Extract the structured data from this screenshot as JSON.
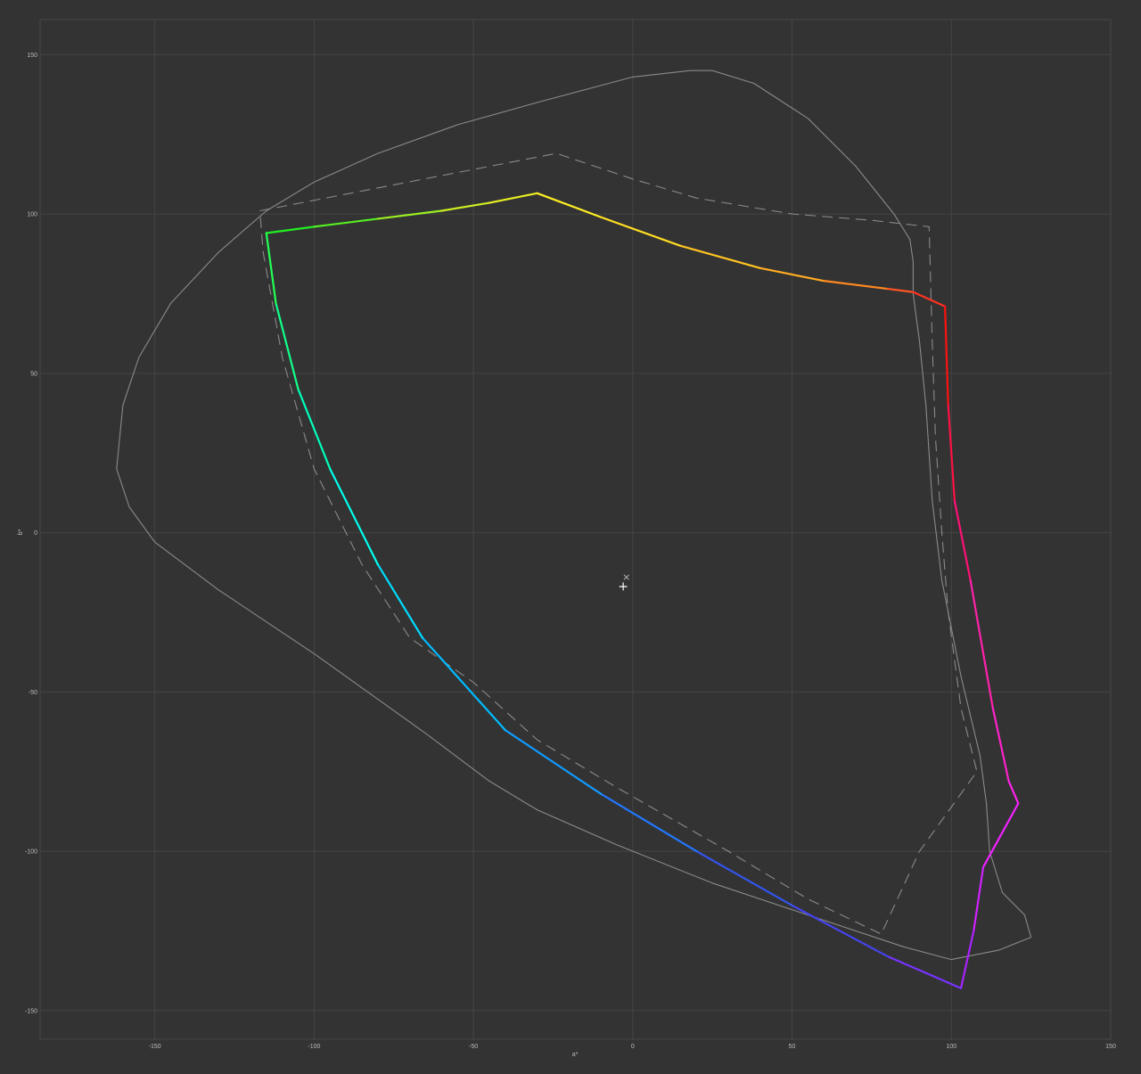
{
  "chart_data": {
    "type": "line",
    "title": "",
    "xlabel": "a*",
    "ylabel": "b*",
    "xlim": [
      -186,
      150
    ],
    "ylim": [
      -159,
      161
    ],
    "x_ticks": [
      -150,
      -100,
      -50,
      0,
      50,
      100,
      150
    ],
    "y_ticks": [
      -150,
      -100,
      -50,
      0,
      50,
      100,
      150
    ],
    "grid": true,
    "legend": "none",
    "colors": {
      "background": "#333333",
      "frame": "#474747",
      "grid": "#454545",
      "tick_text": "#bdbdbd",
      "reference_line": "#8a8a8a"
    },
    "series": [
      {
        "style": "solid-gray",
        "points": [
          [
            18,
            145
          ],
          [
            0,
            143
          ],
          [
            -30,
            135
          ],
          [
            -55,
            128
          ],
          [
            -80,
            119
          ],
          [
            -100,
            110
          ],
          [
            -115,
            101
          ],
          [
            -130,
            88
          ],
          [
            -145,
            72
          ],
          [
            -155,
            55
          ],
          [
            -160,
            40
          ],
          [
            -162,
            20
          ],
          [
            -158,
            8
          ],
          [
            -150,
            -3
          ],
          [
            -130,
            -18
          ],
          [
            -100,
            -38
          ],
          [
            -65,
            -63
          ],
          [
            -45,
            -78
          ],
          [
            -30,
            -87
          ],
          [
            -5,
            -98
          ],
          [
            25,
            -110
          ],
          [
            55,
            -120
          ],
          [
            85,
            -130
          ],
          [
            100,
            -134
          ],
          [
            115,
            -131
          ],
          [
            125,
            -127
          ],
          [
            123,
            -120
          ],
          [
            116,
            -113
          ],
          [
            112,
            -100
          ],
          [
            111,
            -85
          ],
          [
            109,
            -70
          ],
          [
            103,
            -45
          ],
          [
            97,
            -15
          ],
          [
            94,
            10
          ],
          [
            92,
            40
          ],
          [
            90,
            60
          ],
          [
            88,
            75
          ],
          [
            88,
            85
          ],
          [
            87,
            92
          ],
          [
            82,
            100
          ],
          [
            70,
            115
          ],
          [
            55,
            130
          ],
          [
            38,
            141
          ],
          [
            25,
            145
          ],
          [
            18,
            145
          ]
        ]
      },
      {
        "style": "dashed-gray",
        "points": [
          [
            -117,
            101
          ],
          [
            -24,
            119
          ],
          [
            0,
            111
          ],
          [
            20,
            105
          ],
          [
            50,
            100
          ],
          [
            75,
            98
          ],
          [
            93,
            96
          ],
          [
            94,
            60
          ],
          [
            95,
            30
          ],
          [
            97,
            0
          ],
          [
            99,
            -25
          ],
          [
            103,
            -55
          ],
          [
            108,
            -75
          ],
          [
            90,
            -100
          ],
          [
            78,
            -126
          ],
          [
            55,
            -115
          ],
          [
            30,
            -100
          ],
          [
            -5,
            -80
          ],
          [
            -30,
            -65
          ],
          [
            -50,
            -47
          ],
          [
            -70,
            -33
          ],
          [
            -85,
            -10
          ],
          [
            -100,
            20
          ],
          [
            -110,
            55
          ],
          [
            -116,
            88
          ],
          [
            -117,
            101
          ]
        ]
      },
      {
        "style": "gradient",
        "points": [
          [
            -115,
            94,
            "#22ee22"
          ],
          [
            -100,
            96,
            "#55ee22"
          ],
          [
            -80,
            98.5,
            "#99ee22"
          ],
          [
            -60,
            101,
            "#ccee22"
          ],
          [
            -45,
            103.5,
            "#e8ee22"
          ],
          [
            -30,
            106.5,
            "#ffee22"
          ],
          [
            -10,
            99,
            "#ffdd22"
          ],
          [
            15,
            90,
            "#ffc422"
          ],
          [
            40,
            83,
            "#ffaa22"
          ],
          [
            60,
            79,
            "#ff8822"
          ],
          [
            80,
            76.5,
            "#ff5522"
          ],
          [
            88,
            75.5,
            "#ff3322"
          ],
          [
            98,
            71,
            "#ff1111"
          ],
          [
            99,
            40,
            "#ff1144"
          ],
          [
            101,
            10,
            "#ff1177"
          ],
          [
            106,
            -15,
            "#ff22aa"
          ],
          [
            113,
            -55,
            "#ff22cc"
          ],
          [
            118,
            -78,
            "#ff22ee"
          ],
          [
            121,
            -85,
            "#f022ff"
          ],
          [
            110,
            -105,
            "#d022ff"
          ],
          [
            107,
            -125,
            "#aa22ff"
          ],
          [
            103,
            -143,
            "#7733ff"
          ],
          [
            80,
            -133,
            "#4444ee"
          ],
          [
            50,
            -117,
            "#3355ee"
          ],
          [
            20,
            -100,
            "#2277ff"
          ],
          [
            -10,
            -82,
            "#1199ff"
          ],
          [
            -40,
            -62,
            "#00bbff"
          ],
          [
            -66,
            -33,
            "#00ddff"
          ],
          [
            -80,
            -10,
            "#00ffee"
          ],
          [
            -95,
            20,
            "#00ffbb"
          ],
          [
            -105,
            45,
            "#11ff88"
          ],
          [
            -112,
            72,
            "#22ff55"
          ],
          [
            -115,
            94,
            "#22ee22"
          ]
        ]
      }
    ],
    "markers": [
      {
        "symbol": "×",
        "x": -2,
        "y": -13.8
      },
      {
        "symbol": "+",
        "x": -3,
        "y": -17
      }
    ]
  }
}
